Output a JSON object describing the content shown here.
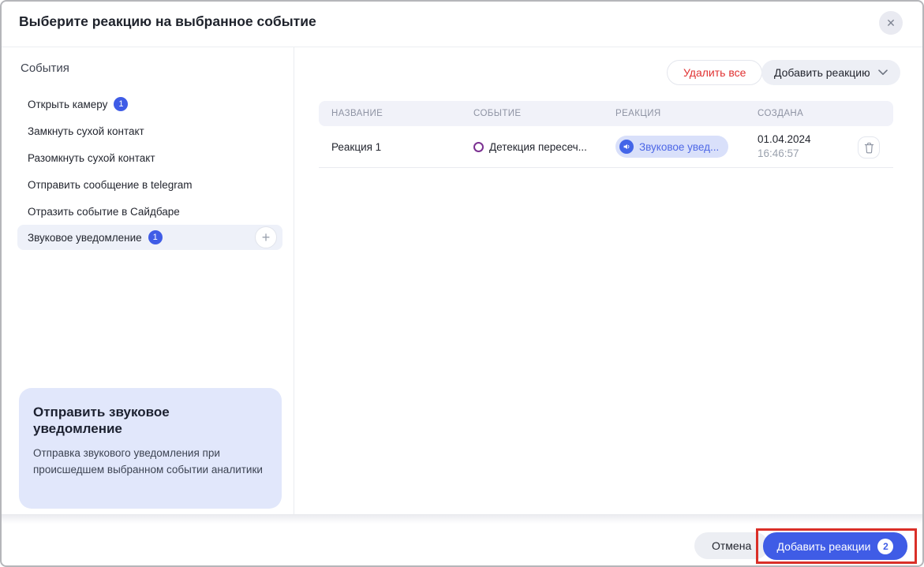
{
  "modal": {
    "title": "Выберите реакцию на выбранное событие"
  },
  "icons": {
    "close": "✕",
    "plus": "+",
    "chevron_down": "v",
    "speaker": "speaker-in-blue-circle",
    "trash": "trash-outline",
    "event_ring": "purple-ring"
  },
  "sidebar": {
    "heading": "События",
    "items": [
      {
        "label": "Открыть камеру",
        "badge": "1"
      },
      {
        "label": "Замкнуть сухой контакт"
      },
      {
        "label": "Разомкнуть сухой контакт"
      },
      {
        "label": "Отправить сообщение в telegram"
      },
      {
        "label": "Отразить событие в Сайдбаре"
      },
      {
        "label": "Звуковое уведомление",
        "badge": "1"
      }
    ],
    "info_box": {
      "title": "Отправить звуковое уведомление",
      "description": "Отправка звукового уведомления при происшедшем выбранном событии аналитики"
    }
  },
  "toolbar": {
    "delete_all_label": "Удалить все",
    "add_reaction_label": "Добавить реакцию"
  },
  "table": {
    "columns": [
      "НАЗВАНИЕ",
      "СОБЫТИЕ",
      "РЕАКЦИЯ",
      "СОЗДАНА"
    ],
    "rows": [
      {
        "name": "Реакция 1",
        "event": "Детекция пересеч...",
        "reaction": "Звуковое увед...",
        "created_date": "01.04.2024",
        "created_time": "16:46:57"
      }
    ]
  },
  "footer": {
    "cancel_label": "Отмена",
    "add_reactions_label": "Добавить реакции",
    "add_reactions_badge": "2"
  },
  "colors": {
    "accent_blue": "#3f5ce6",
    "pill_bg": "#d9e0fa",
    "pill_text": "#4d67e6",
    "event_ring": "#7b3191",
    "danger_red": "#e03131",
    "annotation_red": "#da2f28",
    "info_box_bg": "#e1e7fb",
    "selected_item_bg": "#eef1f9",
    "table_header_bg": "#f1f2f9",
    "muted_text": "#9aa1ad"
  }
}
